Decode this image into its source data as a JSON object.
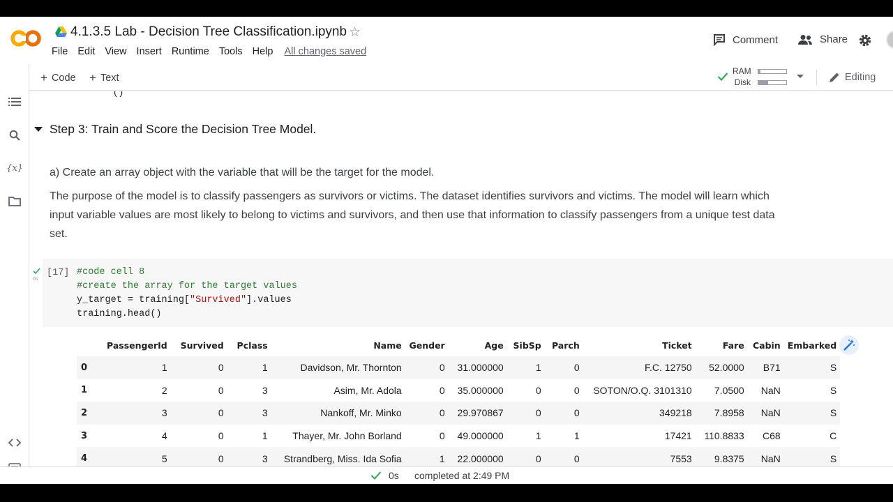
{
  "header": {
    "title": "4.1.3.5 Lab - Decision Tree Classification.ipynb",
    "menu": [
      "File",
      "Edit",
      "View",
      "Insert",
      "Runtime",
      "Tools",
      "Help"
    ],
    "save_status": "All changes saved",
    "comment_label": "Comment",
    "share_label": "Share"
  },
  "toolbar": {
    "add_code": "Code",
    "add_text": "Text",
    "ram_label": "RAM",
    "disk_label": "Disk",
    "ram_usage": 0.08,
    "disk_usage": 0.35,
    "mode": "Editing"
  },
  "section": {
    "prev_cut_text": "(          )",
    "title": "Step 3: Train and Score the Decision Tree Model.",
    "step_a": "a) Create an array object with the variable that will be the target for the model.",
    "purpose": "The purpose of the model is to classify passengers as survivors or victims. The dataset identifies survivors and victims. The model will learn which input variable values are most likely to belong to victims and survivors, and then use that information to classify passengers from a unique test data set."
  },
  "cell": {
    "exec_count": "[17]",
    "exec_time": "0s",
    "code_lines": {
      "l1": "#code cell 8",
      "l2": "#create the array for the target values",
      "l3a": "y_target = training[",
      "l3s": "\"Survived\"",
      "l3b": "].values",
      "l4": "training.head()"
    }
  },
  "dataframe": {
    "columns": [
      "",
      "PassengerId",
      "Survived",
      "Pclass",
      "Name",
      "Gender",
      "Age",
      "SibSp",
      "Parch",
      "Ticket",
      "Fare",
      "Cabin",
      "Embarked"
    ],
    "rows": [
      [
        "0",
        "1",
        "0",
        "1",
        "Davidson, Mr. Thornton",
        "0",
        "31.000000",
        "1",
        "0",
        "F.C. 12750",
        "52.0000",
        "B71",
        "S"
      ],
      [
        "1",
        "2",
        "0",
        "3",
        "Asim, Mr. Adola",
        "0",
        "35.000000",
        "0",
        "0",
        "SOTON/O.Q. 3101310",
        "7.0500",
        "NaN",
        "S"
      ],
      [
        "2",
        "3",
        "0",
        "3",
        "Nankoff, Mr. Minko",
        "0",
        "29.970867",
        "0",
        "0",
        "349218",
        "7.8958",
        "NaN",
        "S"
      ],
      [
        "3",
        "4",
        "0",
        "1",
        "Thayer, Mr. John Borland",
        "0",
        "49.000000",
        "1",
        "1",
        "17421",
        "110.8833",
        "C68",
        "C"
      ],
      [
        "4",
        "5",
        "0",
        "3",
        "Strandberg, Miss. Ida Sofia",
        "1",
        "22.000000",
        "0",
        "0",
        "7553",
        "9.8375",
        "NaN",
        "S"
      ]
    ]
  },
  "status": {
    "duration": "0s",
    "completed": "completed at 2:49 PM"
  },
  "colors": {
    "accent_orange": "#F9AB00",
    "check_green": "#34A853",
    "comment_green": "#2E7D32",
    "string_red": "#A31515"
  }
}
